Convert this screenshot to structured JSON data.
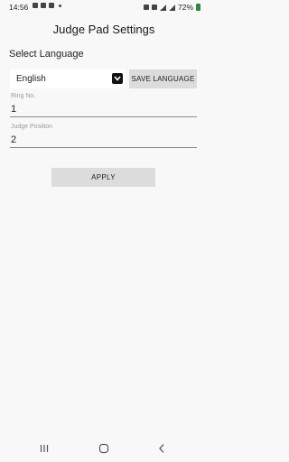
{
  "status_bar": {
    "time": "14:56",
    "battery": "72%",
    "battery_color": "#2b8a3e"
  },
  "header": {
    "title": "Judge Pad Settings"
  },
  "language": {
    "section_label": "Select Language",
    "selected": "English",
    "save_label": "SAVE LANGUAGE"
  },
  "ring": {
    "label": "Ring No.",
    "value": "1"
  },
  "judge_position": {
    "label": "Judge Position",
    "value": "2"
  },
  "actions": {
    "apply_label": "APPLY"
  },
  "nav": {
    "recents_icon": "recents-icon",
    "home_icon": "home-icon",
    "back_icon": "back-icon"
  }
}
